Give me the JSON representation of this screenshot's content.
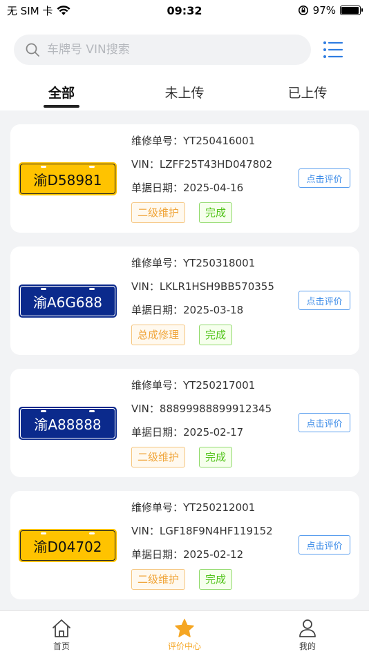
{
  "status": {
    "carrier": "无 SIM 卡",
    "time": "09:32",
    "battery": "97%",
    "battery_level": 0.97
  },
  "search": {
    "placeholder": "车牌号 VIN搜索"
  },
  "tabs": [
    {
      "label": "全部"
    },
    {
      "label": "未上传"
    },
    {
      "label": "已上传"
    }
  ],
  "labels": {
    "order": "维修单号：",
    "vin": "VIN：",
    "date": "单据日期：",
    "eval": "点击评价"
  },
  "records": [
    {
      "plate": "渝D58981",
      "plate_color": "yellow",
      "order": "YT250416001",
      "vin": "LZFF25T43HD047802",
      "date": "2025-04-16",
      "type": "二级维护",
      "status": "完成"
    },
    {
      "plate": "渝A6G688",
      "plate_color": "blue",
      "order": "YT250318001",
      "vin": "LKLR1HSH9BB570355",
      "date": "2025-03-18",
      "type": "总成修理",
      "status": "完成"
    },
    {
      "plate": "渝A88888",
      "plate_color": "blue",
      "order": "YT250217001",
      "vin": "88899988899912345",
      "date": "2025-02-17",
      "type": "二级维护",
      "status": "完成"
    },
    {
      "plate": "渝D04702",
      "plate_color": "yellow",
      "order": "YT250212001",
      "vin": "LGF18F9N4HF119152",
      "date": "2025-02-12",
      "type": "二级维护",
      "status": "完成"
    }
  ],
  "tabbar": [
    {
      "label": "首页",
      "icon": "home-icon"
    },
    {
      "label": "评价中心",
      "icon": "star-icon"
    },
    {
      "label": "我的",
      "icon": "user-icon"
    }
  ],
  "colors": {
    "accent": "#f5a623",
    "link": "#3b8be8",
    "plate_yellow": "#ffc300",
    "plate_blue": "#0b2a8c"
  }
}
